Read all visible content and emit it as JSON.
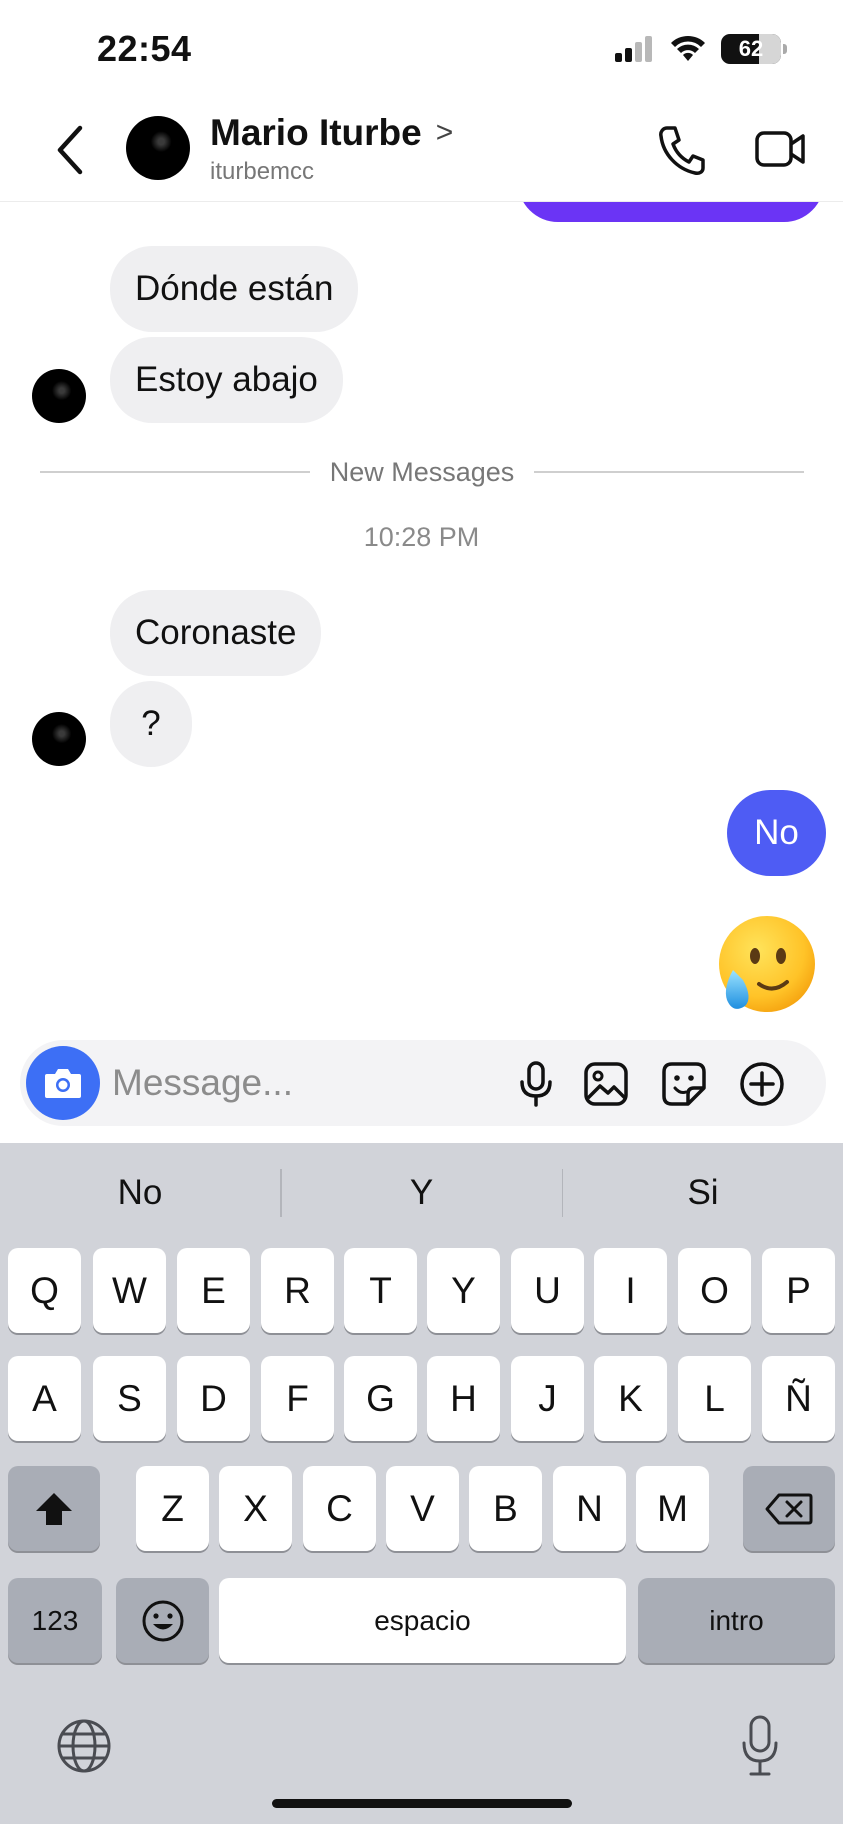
{
  "status_bar": {
    "time": "22:54",
    "battery": "62",
    "icons": [
      "cellular-signal-icon",
      "wifi-icon",
      "battery-icon"
    ]
  },
  "header": {
    "name": "Mario Iturbe",
    "username": "iturbemcc",
    "chevron": ">",
    "icons": [
      "back-icon",
      "phone-icon",
      "video-camera-icon"
    ]
  },
  "messages": {
    "incoming_1": "Dónde están",
    "incoming_2": "Estoy abajo",
    "divider_label": "New Messages",
    "timestamp": "10:28 PM",
    "incoming_3": "Coronaste",
    "incoming_4": "?",
    "outgoing_1": "No",
    "outgoing_emoji": "face-holding-back-tears-emoji"
  },
  "composer": {
    "placeholder": "Message...",
    "icons": [
      "camera-icon",
      "microphone-icon",
      "image-icon",
      "sticker-icon",
      "plus-circle-icon"
    ]
  },
  "colors": {
    "outgoing_bubble": "#4e5cf4",
    "sent_partial": "#6b34f5",
    "camera_button": "#3d6ff5",
    "incoming_bubble": "#efeff1",
    "keyboard_bg": "#d1d3d9"
  },
  "keyboard": {
    "suggestions": [
      "No",
      "Y",
      "Si"
    ],
    "row1": [
      "Q",
      "W",
      "E",
      "R",
      "T",
      "Y",
      "U",
      "I",
      "O",
      "P"
    ],
    "row2": [
      "A",
      "S",
      "D",
      "F",
      "G",
      "H",
      "J",
      "K",
      "L",
      "Ñ"
    ],
    "row3": [
      "Z",
      "X",
      "C",
      "V",
      "B",
      "N",
      "M"
    ],
    "numbers_label": "123",
    "space_label": "espacio",
    "return_label": "intro"
  }
}
